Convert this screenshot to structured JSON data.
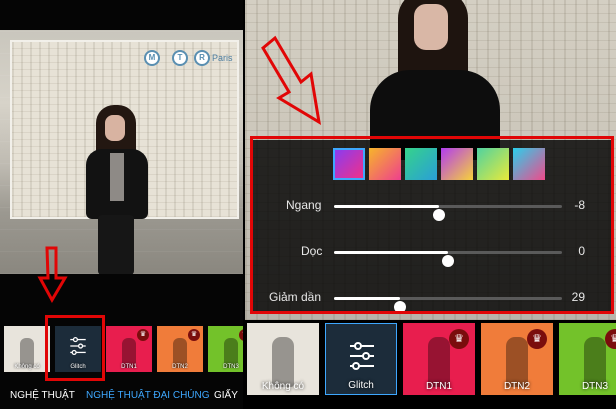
{
  "left": {
    "photo_sign": "Paris",
    "thumbnails": [
      {
        "label": "Không có",
        "color": "#e8e4dc",
        "premium": false
      },
      {
        "label": "Glitch",
        "color": "#1c2c3a",
        "premium": false,
        "selected": true
      },
      {
        "label": "DTN1",
        "color": "#e81e4e",
        "premium": true
      },
      {
        "label": "DTN2",
        "color": "#f07c3a",
        "premium": true
      },
      {
        "label": "DTN3",
        "color": "#73c22a",
        "premium": true
      }
    ],
    "tabs": [
      {
        "label": "NGHỆ THUẬT",
        "active": false
      },
      {
        "label": "NGHỆ THUẬT ĐẠI CHÚNG",
        "active": true
      },
      {
        "label": "GIẤY",
        "active": false
      }
    ]
  },
  "right": {
    "gradient_swatches": [
      {
        "name": "purple-pink-gradient",
        "colors": [
          "#8a3cf0",
          "#f0308a"
        ],
        "selected": true
      },
      {
        "name": "orange-pink-gradient",
        "colors": [
          "#f7b52a",
          "#ee3f8e"
        ],
        "selected": false
      },
      {
        "name": "green-teal-gradient",
        "colors": [
          "#35d38a",
          "#2a9ed8"
        ],
        "selected": false
      },
      {
        "name": "purple-yellow-gradient",
        "colors": [
          "#b13cf0",
          "#f7d23a"
        ],
        "selected": false
      },
      {
        "name": "green-yellow-gradient",
        "colors": [
          "#4fd2a0",
          "#e9ea3a"
        ],
        "selected": false
      },
      {
        "name": "cyan-pink-gradient",
        "colors": [
          "#2ad0ec",
          "#f04a8a"
        ],
        "selected": false
      }
    ],
    "sliders": [
      {
        "label": "Ngang",
        "value": "-8",
        "level": 0.46
      },
      {
        "label": "Dọc",
        "value": "0",
        "level": 0.5
      },
      {
        "label": "Giảm dần",
        "value": "29",
        "level": 0.29
      }
    ],
    "thumbnails": [
      {
        "label": "Không có",
        "color": "#e8e4dc",
        "premium": false
      },
      {
        "label": "Glitch",
        "color": "#1c2c3a",
        "premium": false,
        "selected": true
      },
      {
        "label": "DTN1",
        "color": "#e81e4e",
        "premium": true
      },
      {
        "label": "DTN2",
        "color": "#f07c3a",
        "premium": true
      },
      {
        "label": "DTN3",
        "color": "#73c22a",
        "premium": true
      }
    ]
  },
  "colors": {
    "accent": "#3ea8ff",
    "highlight": "#e10606",
    "premium_badge": "#7a0d0d"
  },
  "icons": {
    "crown": "crown-icon",
    "glitch": "sliders-icon",
    "annotation": "arrow-icon"
  }
}
